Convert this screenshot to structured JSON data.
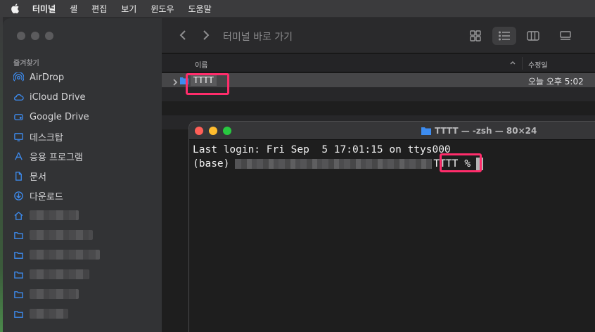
{
  "menubar": {
    "app_name": "터미널",
    "items": [
      "셸",
      "편집",
      "보기",
      "윈도우",
      "도움말"
    ]
  },
  "finder": {
    "toolbar_title": "터미널 바로 가기",
    "sidebar_section": "즐겨찾기",
    "sidebar_items": [
      {
        "label": "AirDrop",
        "icon": "airdrop-icon"
      },
      {
        "label": "iCloud Drive",
        "icon": "cloud-icon"
      },
      {
        "label": "Google Drive",
        "icon": "drive-icon"
      },
      {
        "label": "데스크탑",
        "icon": "desktop-icon"
      },
      {
        "label": "응용 프로그램",
        "icon": "apps-icon"
      },
      {
        "label": "문서",
        "icon": "document-icon"
      },
      {
        "label": "다운로드",
        "icon": "download-icon"
      }
    ],
    "columns": {
      "name": "이름",
      "date": "수정일"
    },
    "rows": [
      {
        "name": "TTTT",
        "date": "오늘 오후 5:02"
      }
    ]
  },
  "terminal": {
    "title": "TTTT — -zsh — 80×24",
    "lines": {
      "login": "Last login: Fri Sep  5 17:01:15 on ttys000",
      "prompt_prefix": "(base)",
      "prompt_dir": "TTTT",
      "prompt_symbol": "%"
    }
  },
  "colors": {
    "highlight": "#ff2d6b",
    "accent": "#3d8cf0"
  }
}
